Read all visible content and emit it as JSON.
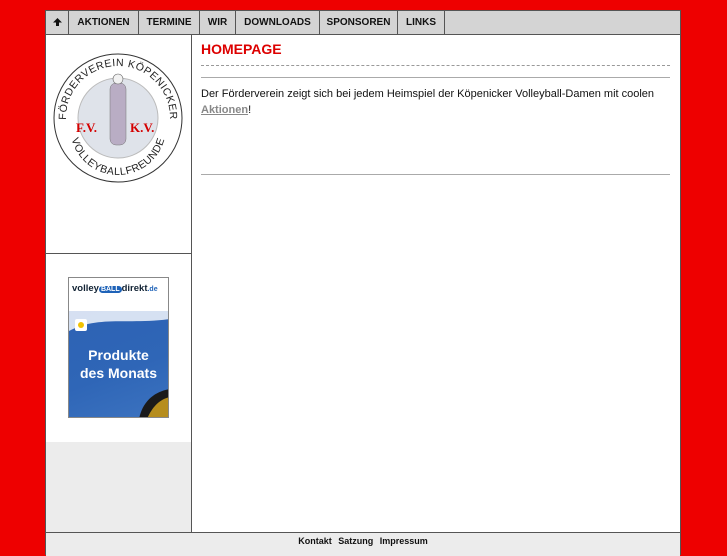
{
  "nav": {
    "home_icon": "up-arrow-icon",
    "items": [
      {
        "label": "AKTIONEN"
      },
      {
        "label": "TERMINE"
      },
      {
        "label": "WIR"
      },
      {
        "label": "DOWNLOADS"
      },
      {
        "label": "SPONSOREN"
      },
      {
        "label": "LINKS"
      }
    ]
  },
  "logo": {
    "arc_top": "FÖRDERVEREIN KÖPENICKER",
    "arc_bottom": "VOLLEYBALLFREUNDE",
    "initials_left": "F.V.",
    "initials_right": "K.V."
  },
  "banner": {
    "brand_prefix": "volley",
    "brand_pill": "BALL",
    "brand_suffix": "direkt",
    "brand_tld": ".de",
    "line1": "Produkte",
    "line2": "des Monats"
  },
  "main": {
    "title": "HOMEPAGE",
    "intro_text": "Der Förderverein zeigt sich bei jedem Heimspiel der Köpenicker Volleyball-Damen mit coolen ",
    "intro_link": "Aktionen",
    "intro_end": "!"
  },
  "footer": {
    "links": [
      {
        "label": "Kontakt"
      },
      {
        "label": "Satzung"
      },
      {
        "label": "Impressum"
      }
    ]
  },
  "colors": {
    "background": "#ee0000",
    "accent_title": "#dd0000",
    "nav_bg": "#d4d4d4",
    "banner_blue": "#2f66b7"
  }
}
